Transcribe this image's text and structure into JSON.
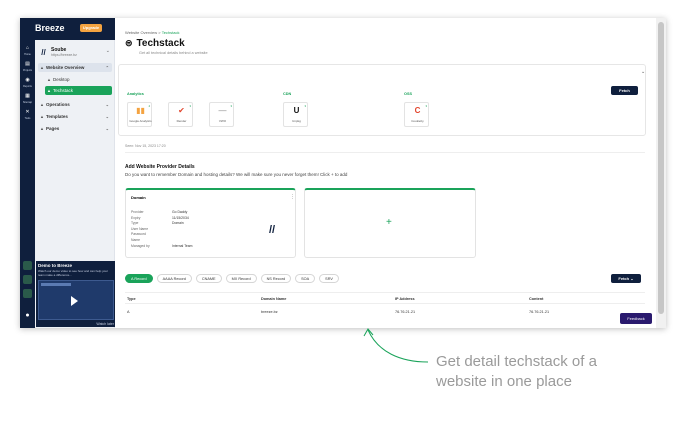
{
  "app": {
    "name": "Breeze",
    "upgrade_label": "Upgrade"
  },
  "rail": {
    "items": [
      {
        "icon": "home-icon",
        "glyph": "⌂",
        "label": "Home"
      },
      {
        "icon": "projects-icon",
        "glyph": "▤",
        "label": "Projects"
      },
      {
        "icon": "reports-icon",
        "glyph": "◉",
        "label": "Reports"
      },
      {
        "icon": "sitemap-icon",
        "glyph": "▦",
        "label": "Sitemap"
      },
      {
        "icon": "tools-icon",
        "glyph": "✕",
        "label": "Tools"
      }
    ]
  },
  "project": {
    "name": "Soube",
    "domain": "https://breeze.bz",
    "glyph": "//"
  },
  "sidebar": {
    "items": [
      {
        "label": "Website Overview",
        "glyph": "▲",
        "type": "section-open"
      },
      {
        "label": "Desktop",
        "glyph": "▲",
        "type": "sub"
      },
      {
        "label": "Techstack",
        "glyph": "▲",
        "type": "sub-active"
      },
      {
        "label": "Operations",
        "glyph": "▲",
        "type": "section"
      },
      {
        "label": "Templates",
        "glyph": "▲",
        "type": "section"
      },
      {
        "label": "Pages",
        "glyph": "▲",
        "type": "section"
      }
    ]
  },
  "demo": {
    "title": "Demo to Breeze",
    "desc": "Watch our demo video to see how and can help your team make a difference...",
    "watch_label": "Watch later"
  },
  "page": {
    "crumb_parent": "Website Overview",
    "crumb_sep": ">",
    "crumb_current": "Techstack",
    "title": "Techstack",
    "subtitle": "Get all technical details behind a website",
    "fetch_label": "Fetch",
    "seen_label": "Seen: Nov 15, 2023 17:20"
  },
  "categories": [
    {
      "name": "Analytics",
      "tiles": [
        {
          "name": "Google Analytics",
          "glyph": "▮▮",
          "color": "#f4a340",
          "badge": "4"
        },
        {
          "name": "Render",
          "glyph": "✔",
          "color": "#e2452d",
          "badge": "3"
        },
        {
          "name": "VWO",
          "glyph": "—",
          "color": "#888888",
          "badge": "3"
        }
      ]
    },
    {
      "name": "CDN",
      "tiles": [
        {
          "name": "Unpkg",
          "glyph": "U",
          "color": "#111111",
          "badge": "3"
        }
      ]
    },
    {
      "name": "OSS",
      "tiles": [
        {
          "name": "Cookieby",
          "glyph": "C",
          "color": "#e2452d",
          "badge": "3"
        }
      ]
    }
  ],
  "provider": {
    "heading": "Add Website Provider Details",
    "prompt": "Do you want to remember Domain and hosting details? We will make sure you never forget them! Click + to add",
    "card_title": "Domain",
    "rows": [
      {
        "label": "Provider",
        "value": "Go Daddy"
      },
      {
        "label": "Expiry",
        "value": "11/15/2034"
      },
      {
        "label": "Type",
        "value": "Domain"
      },
      {
        "label": "User Name",
        "value": ""
      },
      {
        "label": "Password",
        "value": ""
      },
      {
        "label": "Name",
        "value": ""
      },
      {
        "label": "Managed by",
        "value": "Internal Team"
      }
    ],
    "add_glyph": "+"
  },
  "dns": {
    "tabs": [
      "A Record",
      "AAAA Record",
      "CNAME",
      "MX Record",
      "NS Record",
      "SOA",
      "SRV"
    ],
    "fetch_label": "Fetch",
    "columns": [
      "Type",
      "Domain Name",
      "IP Address",
      "Content"
    ],
    "rows": [
      [
        "A",
        "breeze.bz",
        "76.76.21.21",
        "76.76.21.21"
      ]
    ]
  },
  "feedback_label": "Feedback",
  "caption": "Get detail techstack of a website in one place",
  "accent": "#1aa35a",
  "navy": "#0f1f3d"
}
